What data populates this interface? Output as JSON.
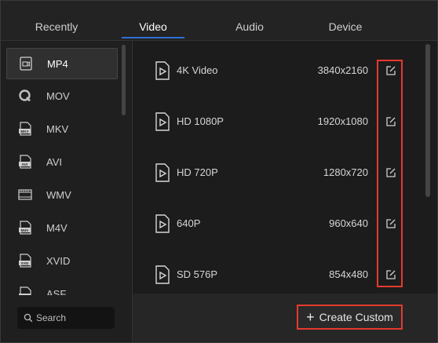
{
  "tabs": [
    {
      "label": "Recently"
    },
    {
      "label": "Video"
    },
    {
      "label": "Audio"
    },
    {
      "label": "Device"
    }
  ],
  "active_tab": "Video",
  "formats": [
    {
      "label": "MP4",
      "icon": "video-file-icon"
    },
    {
      "label": "MOV",
      "icon": "quicktime-icon"
    },
    {
      "label": "MKV",
      "icon": "mkv-file-icon"
    },
    {
      "label": "AVI",
      "icon": "avi-file-icon"
    },
    {
      "label": "WMV",
      "icon": "wmv-file-icon"
    },
    {
      "label": "M4V",
      "icon": "m4v-file-icon"
    },
    {
      "label": "XVID",
      "icon": "xvid-file-icon"
    },
    {
      "label": "ASF",
      "icon": "asf-file-icon"
    }
  ],
  "selected_format": "MP4",
  "search": {
    "placeholder": "Search"
  },
  "presets": [
    {
      "name": "4K Video",
      "resolution": "3840x2160"
    },
    {
      "name": "HD 1080P",
      "resolution": "1920x1080"
    },
    {
      "name": "HD 720P",
      "resolution": "1280x720"
    },
    {
      "name": "640P",
      "resolution": "960x640"
    },
    {
      "name": "SD 576P",
      "resolution": "854x480"
    }
  ],
  "create_custom_label": "Create Custom",
  "colors": {
    "accent": "#2b6fd6",
    "highlight_border": "#e53a2e"
  }
}
